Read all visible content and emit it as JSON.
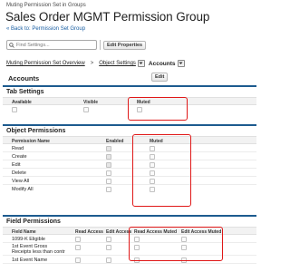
{
  "header": {
    "breadcrumb": "Muting Permission Set in Groups",
    "title": "Sales Order MGMT Permission Group",
    "back_link": "« Back to: Permission Set Group"
  },
  "toolbar": {
    "search_placeholder": "Find Settings...",
    "edit_properties": "Edit Properties",
    "icons": [
      "search-icon"
    ]
  },
  "nav": {
    "muting_link": "Muting Permission Set Overview",
    "separator": ">",
    "object_settings": "Object Settings",
    "current": "Accounts"
  },
  "panel": {
    "title": "Accounts",
    "edit_label": "Edit"
  },
  "tab_settings": {
    "title": "Tab Settings",
    "columns": [
      "Available",
      "Visible",
      "Muted"
    ]
  },
  "object_permissions": {
    "title": "Object Permissions",
    "columns": [
      "Permission Name",
      "Enabled",
      "Muted"
    ],
    "rows": [
      {
        "name": "Read",
        "enabled": true
      },
      {
        "name": "Create",
        "enabled": true
      },
      {
        "name": "Edit",
        "enabled": true
      },
      {
        "name": "Delete",
        "enabled": false
      },
      {
        "name": "View All",
        "enabled": false
      },
      {
        "name": "Modify All",
        "enabled": false
      }
    ]
  },
  "field_permissions": {
    "title": "Field Permissions",
    "columns": [
      "Field Name",
      "Read Access",
      "Edit Access",
      "Read Access Muted",
      "Edit Access Muted"
    ],
    "rows": [
      {
        "name": "1099-K Eligible"
      },
      {
        "name": "1st Event Gross Receipts less than contr"
      },
      {
        "name": "1st Event Name"
      }
    ]
  },
  "colors": {
    "link": "#1a5fa3",
    "section_border": "#1d5b8f",
    "highlight": "#e01818"
  }
}
